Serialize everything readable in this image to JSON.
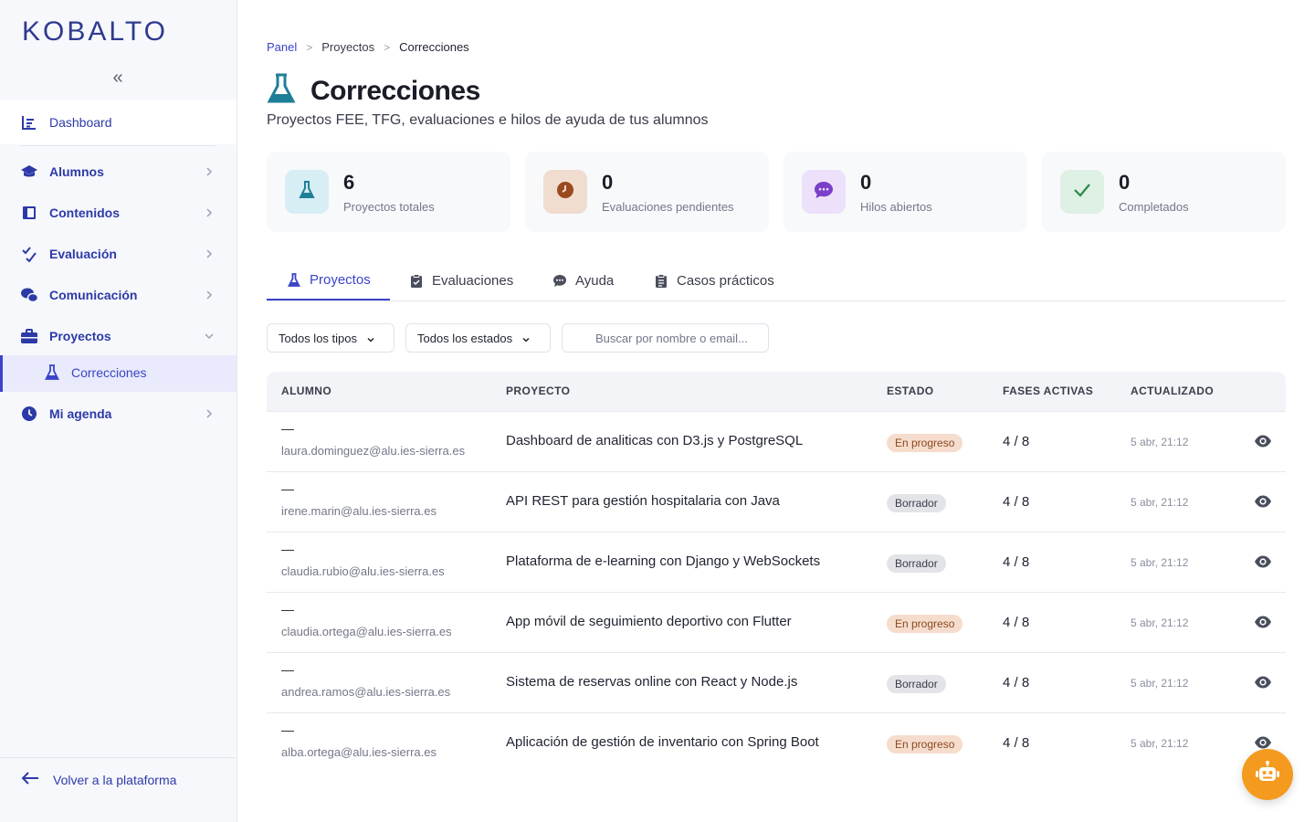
{
  "brand": {
    "logo": "KOBALTO"
  },
  "sidebar": {
    "collapse_icon": "double-chevron-left-icon",
    "dashboard": "Dashboard",
    "items": [
      {
        "label": "Alumnos",
        "icon": "graduation-cap-icon"
      },
      {
        "label": "Contenidos",
        "icon": "book-icon"
      },
      {
        "label": "Evaluación",
        "icon": "check-list-icon"
      },
      {
        "label": "Comunicación",
        "icon": "chat-bubbles-icon"
      },
      {
        "label": "Proyectos",
        "icon": "briefcase-icon",
        "expanded": true
      },
      {
        "label": "Mi agenda",
        "icon": "clock-icon"
      }
    ],
    "sub_active": "Correcciones",
    "back": "Volver a la plataforma"
  },
  "breadcrumb": [
    "Panel",
    "Proyectos",
    "Correcciones"
  ],
  "page": {
    "title": "Correcciones",
    "subtitle": "Proyectos FEE, TFG, evaluaciones e hilos de ayuda de tus alumnos"
  },
  "stats": [
    {
      "value": "6",
      "label": "Proyectos totales",
      "icon": "flask-icon",
      "bg": "#d6eef4",
      "fg": "#1f7f98"
    },
    {
      "value": "0",
      "label": "Evaluaciones pendientes",
      "icon": "clock-icon",
      "bg": "#f0ddd0",
      "fg": "#9b4a1d"
    },
    {
      "value": "0",
      "label": "Hilos abiertos",
      "icon": "chat-icon",
      "bg": "#ece0fa",
      "fg": "#7b3fc9"
    },
    {
      "value": "0",
      "label": "Completados",
      "icon": "check-icon",
      "bg": "#dff0e4",
      "fg": "#2a8a4a"
    }
  ],
  "tabs": [
    {
      "label": "Proyectos",
      "active": true
    },
    {
      "label": "Evaluaciones",
      "active": false
    },
    {
      "label": "Ayuda",
      "active": false
    },
    {
      "label": "Casos prácticos",
      "active": false
    }
  ],
  "filters": {
    "type": "Todos los tipos",
    "status": "Todos los estados",
    "search_placeholder": "Buscar por nombre o email..."
  },
  "table": {
    "headers": [
      "ALUMNO",
      "PROYECTO",
      "ESTADO",
      "FASES ACTIVAS",
      "ACTUALIZADO"
    ],
    "rows": [
      {
        "name": "—",
        "email": "laura.dominguez@alu.ies-sierra.es",
        "project": "Dashboard de analiticas con D3.js y PostgreSQL",
        "status": "En progreso",
        "phases": "4 / 8",
        "updated": "5 abr, 21:12"
      },
      {
        "name": "—",
        "email": "irene.marin@alu.ies-sierra.es",
        "project": "API REST para gestión hospitalaria con Java",
        "status": "Borrador",
        "phases": "4 / 8",
        "updated": "5 abr, 21:12"
      },
      {
        "name": "—",
        "email": "claudia.rubio@alu.ies-sierra.es",
        "project": "Plataforma de e-learning con Django y WebSockets",
        "status": "Borrador",
        "phases": "4 / 8",
        "updated": "5 abr, 21:12"
      },
      {
        "name": "—",
        "email": "claudia.ortega@alu.ies-sierra.es",
        "project": "App móvil de seguimiento deportivo con Flutter",
        "status": "En progreso",
        "phases": "4 / 8",
        "updated": "5 abr, 21:12"
      },
      {
        "name": "—",
        "email": "andrea.ramos@alu.ies-sierra.es",
        "project": "Sistema de reservas online con React y Node.js",
        "status": "Borrador",
        "phases": "4 / 8",
        "updated": "5 abr, 21:12"
      },
      {
        "name": "—",
        "email": "alba.ortega@alu.ies-sierra.es",
        "project": "Aplicación de gestión de inventario con Spring Boot",
        "status": "En progreso",
        "phases": "4 / 8",
        "updated": "5 abr, 21:12"
      }
    ]
  },
  "colors": {
    "accent": "#3b44c7",
    "brand": "#2f3a8f",
    "assistant": "#f39a1f"
  },
  "assistant": {
    "icon": "robot-icon"
  }
}
